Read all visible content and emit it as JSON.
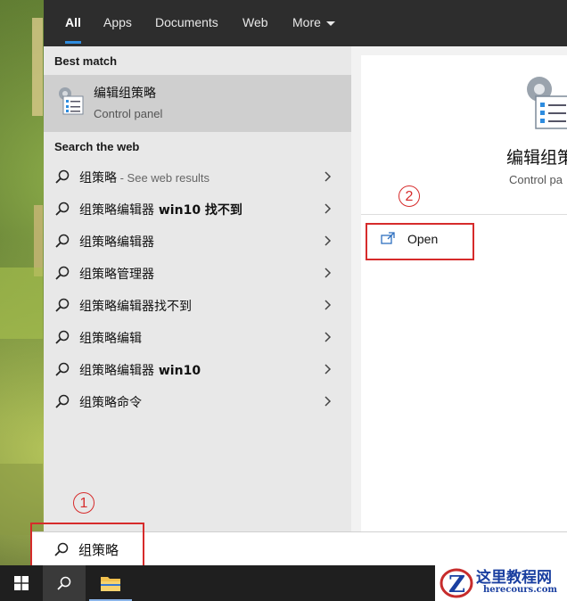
{
  "tabs": [
    {
      "label": "All"
    },
    {
      "label": "Apps"
    },
    {
      "label": "Documents"
    },
    {
      "label": "Web"
    },
    {
      "label": "More"
    }
  ],
  "best_match": {
    "heading": "Best match",
    "title": "编辑组策略",
    "subtitle": "Control panel"
  },
  "search_web": {
    "heading": "Search the web",
    "items": [
      {
        "text": "组策略",
        "suffix": " - See web results"
      },
      {
        "text": "组策略编辑器",
        "bold": " win10 找不到"
      },
      {
        "text": "组策略编辑器"
      },
      {
        "text": "组策略管理器"
      },
      {
        "text": "组策略编辑器找不到"
      },
      {
        "text": "组策略编辑"
      },
      {
        "text": "组策略编辑器",
        "bold": " win10"
      },
      {
        "text": "组策略命令"
      }
    ]
  },
  "preview": {
    "title": "编辑组策",
    "subtitle": "Control pa",
    "open_label": "Open"
  },
  "search": {
    "query": "组策略"
  },
  "annotations": {
    "step1": "1",
    "step2": "2"
  },
  "watermark": {
    "name": "这里教程网",
    "url": "herecours.com"
  },
  "colors": {
    "accent": "#2e8cdf",
    "annotation": "#d62b2b"
  }
}
